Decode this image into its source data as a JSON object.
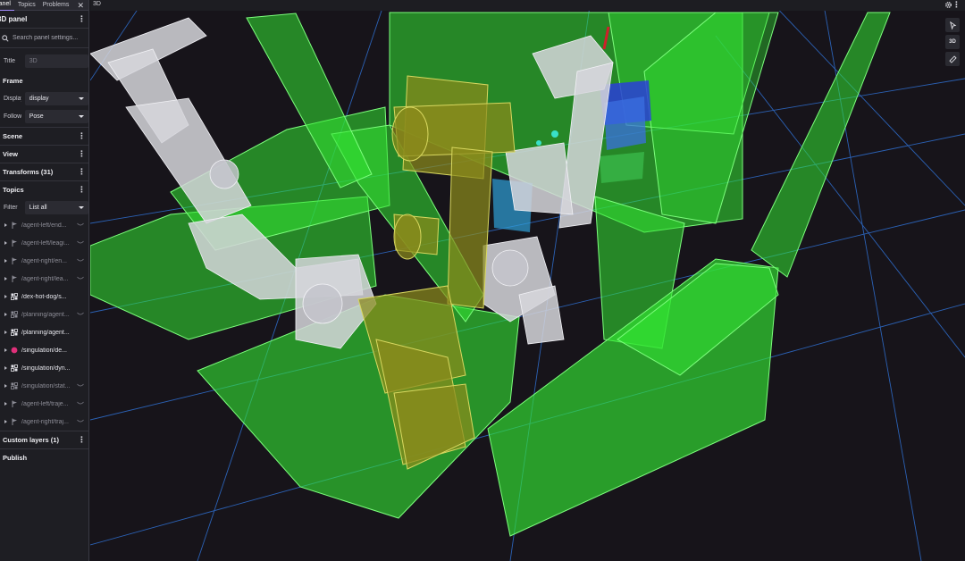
{
  "tabs": [
    {
      "label": "Panel"
    },
    {
      "label": "Topics"
    },
    {
      "label": "Problems"
    }
  ],
  "panel": {
    "title": "3D panel",
    "search_placeholder": "Search panel settings..."
  },
  "general": {
    "title_label": "Title",
    "title_placeholder": "3D"
  },
  "frame": {
    "section": "Frame",
    "display_label": "Display frame",
    "display_value": "display",
    "follow_label": "Follow mode",
    "follow_value": "Pose"
  },
  "sections": {
    "scene": "Scene",
    "view": "View",
    "transforms": "Transforms (31)",
    "topics": "Topics",
    "custom_layers": "Custom layers (1)",
    "publish": "Publish"
  },
  "topics_filter": {
    "label": "Filter",
    "value": "List all"
  },
  "topics": [
    {
      "label": "/agent-left/end...",
      "icon": "pose-flag-icon",
      "visible": false
    },
    {
      "label": "/agent-left/leagi...",
      "icon": "pose-flag-icon",
      "visible": false
    },
    {
      "label": "/agent-right/en...",
      "icon": "pose-flag-icon",
      "visible": false
    },
    {
      "label": "/agent-right/lea...",
      "icon": "pose-flag-icon",
      "visible": false
    },
    {
      "label": "/dex-hot-dog/s...",
      "icon": "scene-update-icon",
      "visible": true
    },
    {
      "label": "/planning/agent...",
      "icon": "scene-update-icon",
      "visible": false
    },
    {
      "label": "/planning/agent...",
      "icon": "scene-update-icon",
      "visible": true
    },
    {
      "label": "/singulation/de...",
      "icon": "marker-dot-icon",
      "visible": true
    },
    {
      "label": "/singulation/dyn...",
      "icon": "scene-update-icon",
      "visible": true
    },
    {
      "label": "/singulation/stat...",
      "icon": "scene-update-icon",
      "visible": false
    },
    {
      "label": "/agent-left/traje...",
      "icon": "pose-flag-icon",
      "visible": false
    },
    {
      "label": "/agent-right/traj...",
      "icon": "pose-flag-icon",
      "visible": false
    }
  ],
  "viewport": {
    "title": "3D",
    "tools": [
      "select-arrow-icon",
      "3D",
      "ruler-icon"
    ]
  },
  "colors": {
    "accent": "#a38cff",
    "box_green": "#33e633",
    "box_olive": "#8a8a1c",
    "grid": "#2f6fd0",
    "marker_dot": "#e0307a"
  }
}
